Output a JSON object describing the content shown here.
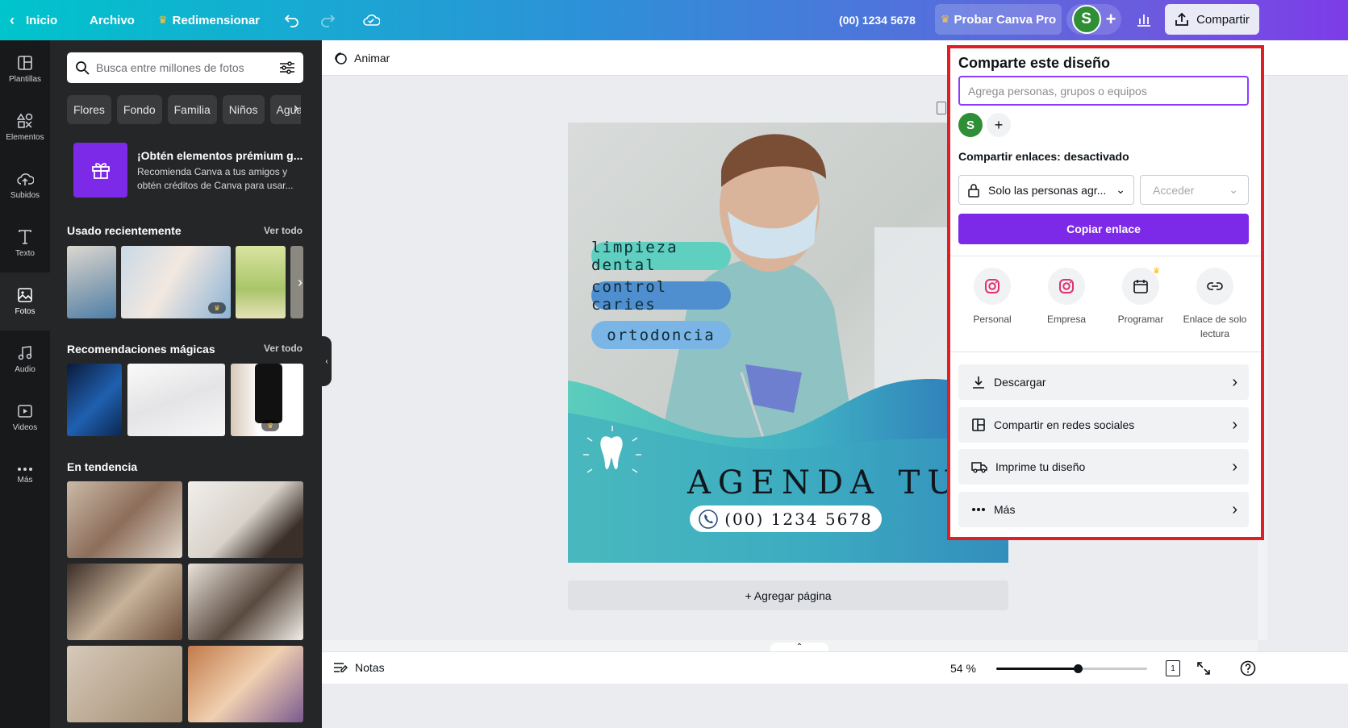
{
  "topbar": {
    "home_label": "Inicio",
    "file_label": "Archivo",
    "resize_label": "Redimensionar",
    "phone_label": "(00) 1234 5678",
    "try_pro_label": "Probar Canva Pro",
    "avatar_initial": "S",
    "share_label": "Compartir"
  },
  "rail": {
    "items": [
      {
        "label": "Plantillas",
        "icon": "templates-icon"
      },
      {
        "label": "Elementos",
        "icon": "elements-icon"
      },
      {
        "label": "Subidos",
        "icon": "upload-cloud-icon"
      },
      {
        "label": "Texto",
        "icon": "text-icon"
      },
      {
        "label": "Fotos",
        "icon": "photos-icon"
      },
      {
        "label": "Audio",
        "icon": "audio-icon"
      },
      {
        "label": "Videos",
        "icon": "video-icon"
      },
      {
        "label": "Más",
        "icon": "more-icon"
      }
    ]
  },
  "panel": {
    "search_placeholder": "Busca entre millones de fotos",
    "chips": [
      "Flores",
      "Fondo",
      "Familia",
      "Niños",
      "Agua"
    ],
    "promo": {
      "title": "¡Obtén elementos prémium g...",
      "description": "Recomienda Canva a tus amigos y obtén créditos de Canva para usar..."
    },
    "recent": {
      "title": "Usado recientemente",
      "see_all": "Ver todo"
    },
    "magic": {
      "title": "Recomendaciones mágicas",
      "see_all": "Ver todo"
    },
    "trending": {
      "title": "En tendencia"
    }
  },
  "editor": {
    "animate_label": "Animar",
    "add_page_label": "+ Agregar página",
    "notes_label": "Notas",
    "zoom_label": "54 %",
    "zoom_value": 0.54,
    "page_number": "1"
  },
  "design": {
    "services": [
      "limpieza dental",
      "control caries",
      "ortodoncia"
    ],
    "cta": "AGENDA TU CITA",
    "phone": "(00) 1234 5678",
    "colors": {
      "teal": "#4fc8bc",
      "blue": "#2f73b5",
      "pill1": "#5fcfc0",
      "pill2": "#4f8fcf",
      "pill3": "#7bb5e6"
    }
  },
  "share_panel": {
    "title": "Comparte este diseño",
    "input_placeholder": "Agrega personas, grupos o equipos",
    "avatar_initial": "S",
    "links_label": "Compartir enlaces: desactivado",
    "access_select": "Solo las personas agr...",
    "permission_select": "Acceder",
    "copy_button": "Copiar enlace",
    "options": [
      {
        "label": "Personal",
        "icon": "instagram-icon"
      },
      {
        "label": "Empresa",
        "icon": "instagram-icon"
      },
      {
        "label": "Programar",
        "icon": "calendar-icon"
      },
      {
        "label": "Enlace de solo lectura",
        "icon": "link-icon"
      }
    ],
    "rows": [
      {
        "label": "Descargar",
        "icon": "download-icon"
      },
      {
        "label": "Compartir en redes sociales",
        "icon": "social-layout-icon"
      },
      {
        "label": "Imprime tu diseño",
        "icon": "truck-icon"
      },
      {
        "label": "Más",
        "icon": "more-dots-icon"
      }
    ],
    "highlight_color": "#e01e26",
    "accent_color": "#7d2ae8"
  }
}
